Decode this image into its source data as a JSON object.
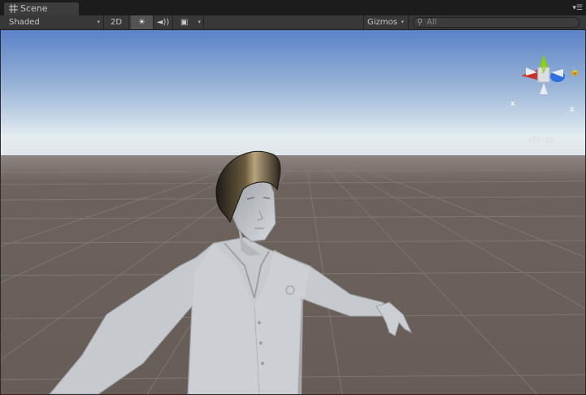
{
  "tab": {
    "title": "Scene",
    "icon": "scene-grid-icon"
  },
  "panel_menu": {
    "icon": "panel-menu-icon",
    "glyph": "▾☰"
  },
  "toolbar": {
    "shading_mode": "Shaded",
    "dropdown_glyph": "▾",
    "mode_2d_label": "2D",
    "lighting_glyph": "☀",
    "lighting_icon": "sun-icon",
    "audio_glyph": "◄))",
    "audio_icon": "speaker-icon",
    "effects_glyph": "▣",
    "effects_icon": "image-effects-icon",
    "gizmos_label": "Gizmos",
    "search_icon_glyph": "⚲",
    "search_placeholder": "All"
  },
  "gizmo": {
    "projection_label": "Persp",
    "lock_glyph": "🔒",
    "axis_x": "x",
    "axis_y": "y",
    "axis_z": "z"
  },
  "scene": {
    "sky_top_color": "#5b82c8",
    "horizon_color": "#eef2f4",
    "ground_color": "#6a5f59",
    "grid_color": "#8a817b",
    "model_color": "#c8cbcf",
    "hair_color": "#2a241b"
  }
}
